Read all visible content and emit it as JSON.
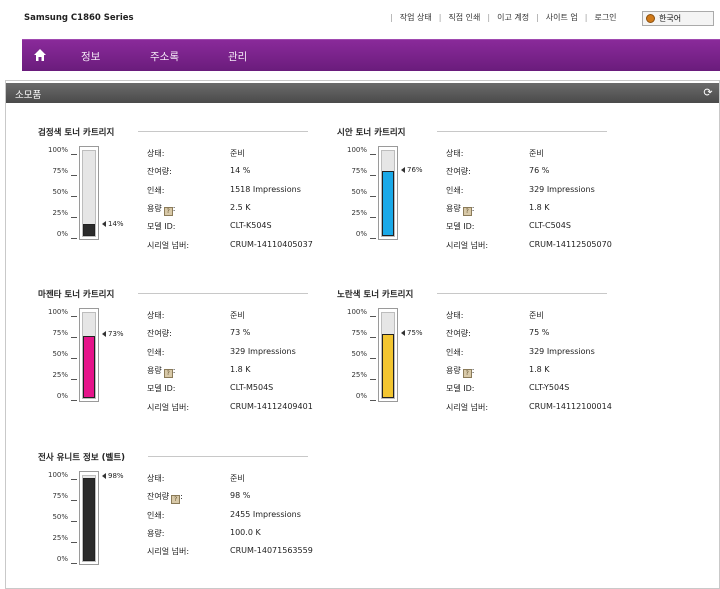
{
  "app": {
    "title": "Samsung C1860 Series"
  },
  "top_links": [
    "작업 상태",
    "직접 인쇄",
    "이고 계정",
    "사이트 업",
    "로그인"
  ],
  "language": {
    "selected": "한국어"
  },
  "nav": {
    "items": [
      "정보",
      "주소록",
      "관리"
    ],
    "home_icon": "home-icon"
  },
  "section": {
    "title": "소모품",
    "refresh_icon": "refresh-icon"
  },
  "gauge_scale": [
    "100%",
    "75%",
    "50%",
    "25%",
    "0%"
  ],
  "field_labels": {
    "status": "상태:",
    "remaining": "잔여량:",
    "printed": "인쇄:",
    "capacity": "용량",
    "model": "모델 ID:",
    "serial": "시리얼 넘버:"
  },
  "cartridges": [
    {
      "title": "검정색 토너 카트리지",
      "level": 14,
      "level_label": "14%",
      "color": "#2b2b2b",
      "status": "준비",
      "remaining": "14 %",
      "printed": "1518 Impressions",
      "capacity": "2.5 K",
      "model": "CLT-K504S",
      "serial": "CRUM-14110405037"
    },
    {
      "title": "시안 토너 카트리지",
      "level": 76,
      "level_label": "76%",
      "color": "#1aa9e8",
      "status": "준비",
      "remaining": "76 %",
      "printed": "329 Impressions",
      "capacity": "1.8 K",
      "model": "CLT-C504S",
      "serial": "CRUM-14112505070"
    },
    {
      "title": "마젠타 토너 카트리지",
      "level": 73,
      "level_label": "73%",
      "color": "#e5148a",
      "status": "준비",
      "remaining": "73 %",
      "printed": "329 Impressions",
      "capacity": "1.8 K",
      "model": "CLT-M504S",
      "serial": "CRUM-14112409401"
    },
    {
      "title": "노란색 토너 카트리지",
      "level": 75,
      "level_label": "75%",
      "color": "#f2c531",
      "status": "준비",
      "remaining": "75 %",
      "printed": "329 Impressions",
      "capacity": "1.8 K",
      "model": "CLT-Y504S",
      "serial": "CRUM-14112100014"
    }
  ],
  "transfer_unit": {
    "title": "전사 유니트 정보 (벨트)",
    "level": 98,
    "level_label": "98%",
    "color": "#2b2b2b",
    "status": "준비",
    "remaining": "98 %",
    "printed": "2455 Impressions",
    "capacity_label": "용량:",
    "capacity": "100.0 K",
    "serial": "CRUM-14071563559"
  },
  "icons": {
    "capacity_help": "info-icon",
    "globe": "globe-icon"
  }
}
